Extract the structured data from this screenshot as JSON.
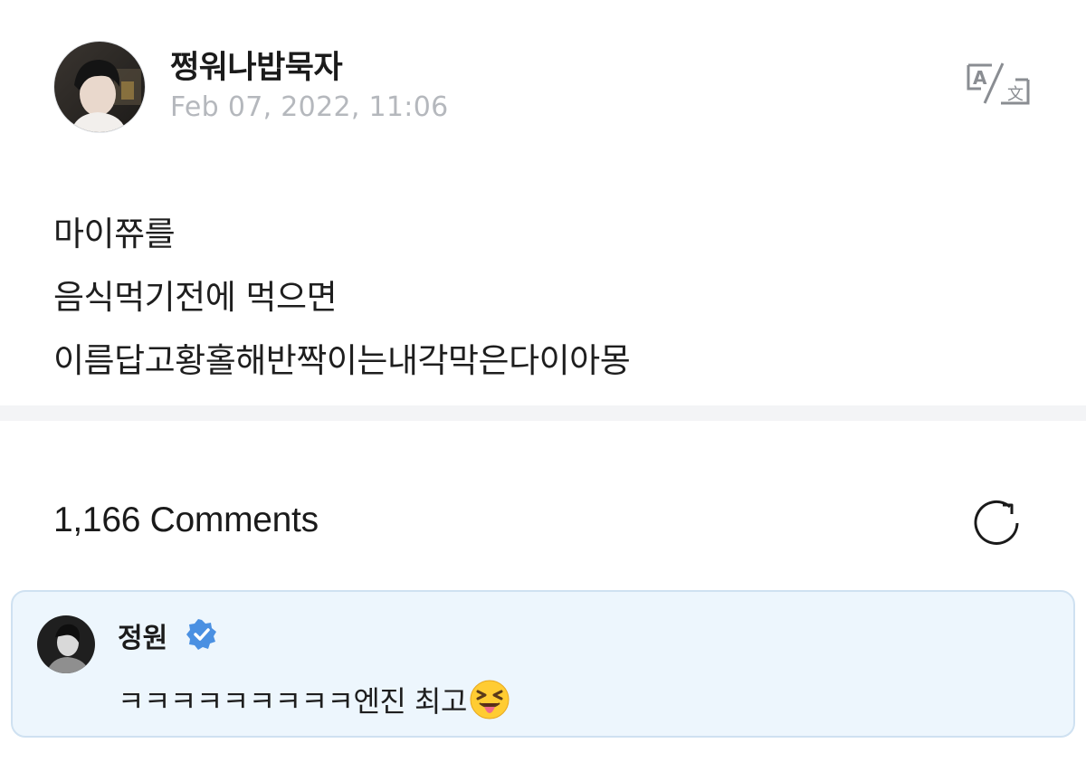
{
  "post": {
    "author": "쩡워나밥묵자",
    "timestamp": "Feb 07, 2022, 11:06",
    "avatar_icon": "profile-photo-icon",
    "translate_icon": "translate-icon",
    "lines": [
      "마이쮸를",
      "음식먹기전에 먹으면",
      "이름답고황홀해반짝이는내각막은다이아몽"
    ]
  },
  "comments": {
    "title": "1,166 Comments",
    "refresh_icon": "refresh-icon",
    "highlighted": {
      "author": "정원",
      "verified": true,
      "verified_icon": "verified-badge-icon",
      "text": "ㅋㅋㅋㅋㅋㅋㅋㅋㅋ엔진 최고",
      "emoji": "squinting-face-with-tongue-icon"
    }
  },
  "colors": {
    "accent": "#4a90e2",
    "timestamp": "#b5b8bd",
    "comment_bg": "#edf6fd",
    "comment_border": "#cfe1f1",
    "divider": "#f3f4f6"
  }
}
